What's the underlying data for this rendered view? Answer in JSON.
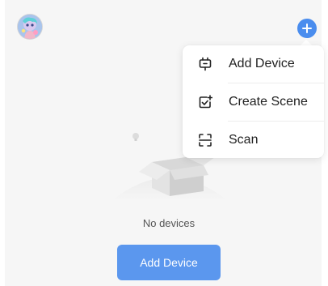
{
  "header": {
    "avatar_icon": "avatar-image-icon",
    "plus_icon": "plus-icon",
    "accent_color": "#4a8dee"
  },
  "popup_menu": {
    "items": [
      {
        "label": "Add Device",
        "icon": "add-device-icon"
      },
      {
        "label": "Create Scene",
        "icon": "create-scene-icon"
      },
      {
        "label": "Scan",
        "icon": "scan-icon"
      }
    ]
  },
  "empty_state": {
    "icon": "empty-box-icon",
    "message": "No devices"
  },
  "actions": {
    "add_device_label": "Add Device",
    "button_color": "#5b97ee"
  }
}
